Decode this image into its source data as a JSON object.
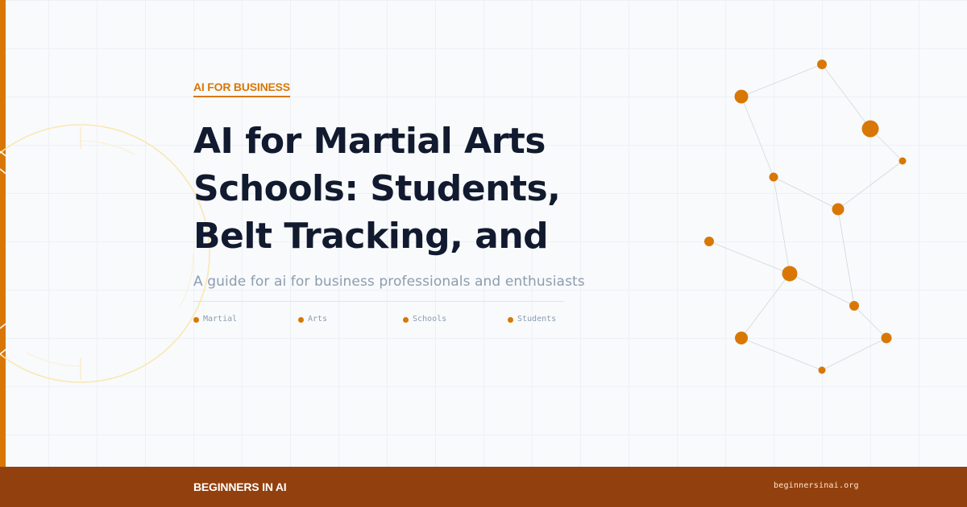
{
  "category_label": "AI FOR BUSINESS",
  "title_lines": [
    "AI for Martial Arts",
    "Schools: Students,",
    "Belt Tracking, and"
  ],
  "subtitle": "A guide for ai for business professionals and enthusiasts",
  "tags": [
    "Martial",
    "Arts",
    "Schools",
    "Students"
  ],
  "footer": {
    "brand": "BEGINNERS IN AI",
    "domain": "beginnersinai.org"
  },
  "colors": {
    "accent": "#d97706",
    "footer_background": "#92400e",
    "title_text": "#111a2e",
    "muted_text": "#8d9cb0",
    "background": "#f8fafc"
  }
}
